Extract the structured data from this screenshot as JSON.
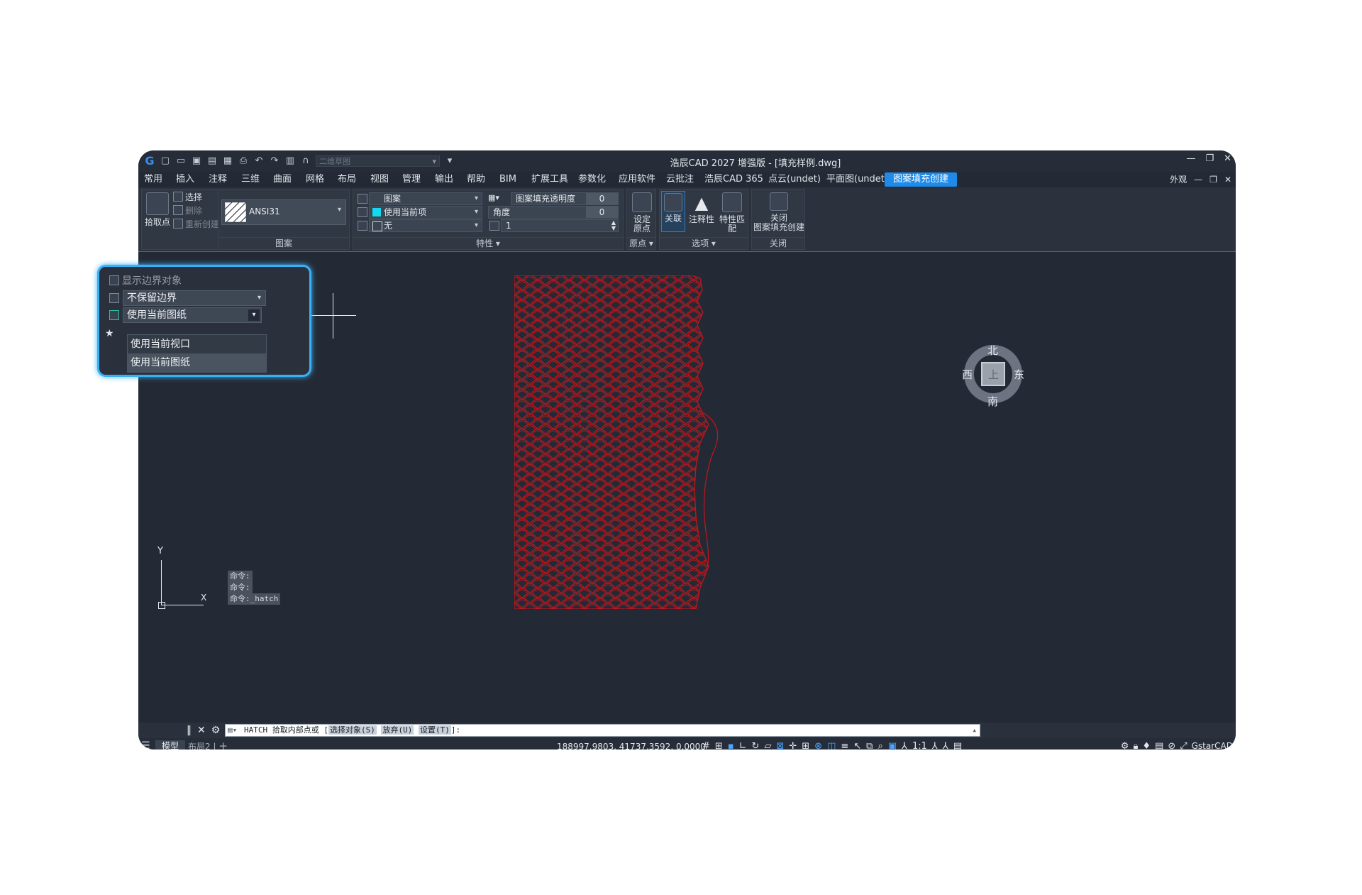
{
  "app": {
    "title": "浩辰CAD 2027 增强版 - [填充样例.dwg]",
    "workspace": "二维草图",
    "status_right": "GstarCAD"
  },
  "menu": {
    "items": [
      "常用",
      "插入",
      "注释",
      "三维",
      "曲面",
      "网格",
      "布局",
      "视图",
      "管理",
      "输出",
      "帮助",
      "BIM",
      "扩展工具",
      "参数化",
      "应用软件",
      "云批注",
      "浩辰CAD 365",
      "点云(undet)",
      "平面图(undet)"
    ],
    "active": "图案填充创建",
    "right": "外观"
  },
  "ribbon": {
    "boundary": {
      "pick_label": "拾取点",
      "select_label": "选择",
      "delete_label": "删除",
      "recreate_label": "重新创建"
    },
    "pattern": {
      "name": "ANSI31",
      "panel_label": "图案"
    },
    "properties": {
      "type": "图案",
      "color": "使用当前项",
      "background": "无",
      "transparency_label": "图案填充透明度",
      "transparency_value": "0",
      "angle_label": "角度",
      "angle_value": "0",
      "scale_value": "1",
      "panel_label": "特性"
    },
    "origin": {
      "set_label_1": "设定",
      "set_label_2": "原点",
      "panel_label": "原点"
    },
    "options": {
      "assoc_label": "关联",
      "annot_label": "注释性",
      "match_label": "特性匹配",
      "panel_label": "选项"
    },
    "close": {
      "label_1": "关闭",
      "label_2": "图案填充创建",
      "panel_label": "关闭"
    }
  },
  "popup": {
    "title": "显示边界对象",
    "retain": "不保留边界",
    "basis": "使用当前图纸",
    "options": [
      "使用当前视口",
      "使用当前图纸"
    ],
    "selected": "使用当前图纸"
  },
  "compass": {
    "north": "北",
    "south": "南",
    "east": "东",
    "west": "西",
    "top": "上"
  },
  "ucs": {
    "y": "Y",
    "x": "X"
  },
  "command": {
    "history": [
      "命令:",
      "命令:",
      "命令:_hatch"
    ],
    "prefix": "HATCH 拾取内部点或 [",
    "opt1": "选择对象(S)",
    "opt2": "放弃(U)",
    "opt3": "设置(T)",
    "suffix": "]:"
  },
  "status": {
    "model_tab": "模型",
    "layout_tab": "布局2",
    "coords": "188997.9803, 41737.3592, 0.0000",
    "scale": "1:1"
  },
  "colors": {
    "hatch": "#c0161c",
    "accent": "#1e8bea",
    "popup_border": "#39b0f5",
    "canvas": "#232a35"
  }
}
